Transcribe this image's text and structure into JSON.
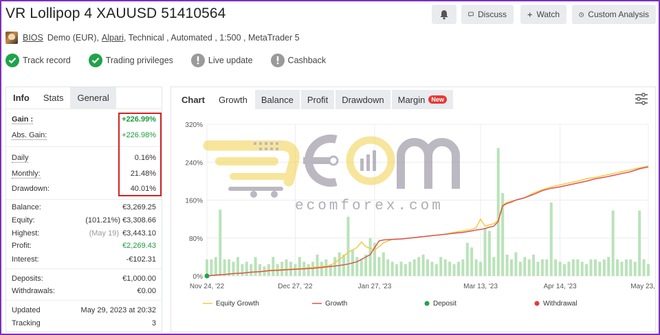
{
  "title": "VR Lollipop 4 XAUUSD 51410564",
  "header_buttons": {
    "discuss": "Discuss",
    "watch": "Watch",
    "custom_analysis": "Custom Analysis"
  },
  "meta": {
    "author": "BIOS",
    "account": "Demo (EUR),",
    "broker": "Alpari",
    "rest": ", Technical , Automated , 1:500 , MetaTrader 5"
  },
  "badges": [
    {
      "label": "Track record",
      "status": "ok"
    },
    {
      "label": "Trading privileges",
      "status": "ok"
    },
    {
      "label": "Live update",
      "status": "off"
    },
    {
      "label": "Cashback",
      "status": "off"
    }
  ],
  "left_tabs": [
    "Info",
    "Stats",
    "General"
  ],
  "stats": {
    "gain": {
      "label": "Gain :",
      "value": "+226.99%"
    },
    "abs_gain": {
      "label": "Abs. Gain:",
      "value": "+226.98%"
    },
    "daily": {
      "label": "Daily",
      "value": "0.16%"
    },
    "monthly": {
      "label": "Monthly:",
      "value": "21.48%"
    },
    "drawdown": {
      "label": "Drawdown:",
      "value": "40.01%"
    },
    "balance": {
      "label": "Balance:",
      "value": "€3,269.25"
    },
    "equity": {
      "label": "Equity:",
      "prefix": "(101.21%)",
      "value": "€3,308.66"
    },
    "highest": {
      "label": "Highest:",
      "prefix": "(May 19)",
      "value": "€3,443.10"
    },
    "profit": {
      "label": "Profit:",
      "value": "€2,269.43"
    },
    "interest": {
      "label": "Interest:",
      "value": "-€102.31"
    },
    "deposits": {
      "label": "Deposits:",
      "value": "€1,000.00"
    },
    "withdrawals": {
      "label": "Withdrawals:",
      "value": "€0.00"
    },
    "updated": {
      "label": "Updated",
      "value": "May 29, 2023 at 20:32"
    },
    "tracking": {
      "label": "Tracking",
      "value": "3"
    }
  },
  "right_tabs": [
    "Chart",
    "Growth",
    "Balance",
    "Profit",
    "Drawdown",
    "Margin"
  ],
  "margin_badge": "New",
  "watermark": {
    "text": "ecomforex.com"
  },
  "colors": {
    "equity": "#f5c842",
    "growth": "#d9534f",
    "deposit": "#1fa34a",
    "withdrawal": "#e53935",
    "bars": "#b9e3b9",
    "positive": "#1a9b3a",
    "highlight": "#d12222"
  },
  "chart_data": {
    "type": "line",
    "ylim": [
      0,
      320
    ],
    "yticks": [
      0,
      80,
      160,
      240,
      320
    ],
    "ytick_labels": [
      "0%",
      "80%",
      "160%",
      "240%",
      "320%"
    ],
    "xtick_labels": [
      "Nov 24, '22",
      "Dec 27, '22",
      "Jan 27, '23",
      "Mar 13, '23",
      "Apr 14, '23",
      "May 23, '23"
    ],
    "xtick_index": [
      0,
      20,
      38,
      62,
      80,
      100
    ],
    "n_points": 101,
    "grid": true,
    "legend": [
      "Equity Growth",
      "Growth",
      "Deposit",
      "Withdrawal"
    ],
    "legend_position": "bottom",
    "equity_growth": [
      [
        0,
        0
      ],
      [
        2,
        2
      ],
      [
        4,
        3
      ],
      [
        6,
        5
      ],
      [
        8,
        6
      ],
      [
        10,
        8
      ],
      [
        12,
        9
      ],
      [
        14,
        12
      ],
      [
        16,
        13
      ],
      [
        18,
        14
      ],
      [
        20,
        15
      ],
      [
        22,
        16
      ],
      [
        24,
        18
      ],
      [
        26,
        20
      ],
      [
        28,
        22
      ],
      [
        29,
        28
      ],
      [
        30,
        35
      ],
      [
        31,
        42
      ],
      [
        32,
        50
      ],
      [
        33,
        55
      ],
      [
        34,
        60
      ],
      [
        35,
        72
      ],
      [
        36,
        62
      ],
      [
        37,
        58
      ],
      [
        38,
        55
      ],
      [
        39,
        62
      ],
      [
        40,
        70
      ],
      [
        42,
        77
      ],
      [
        44,
        78
      ],
      [
        46,
        80
      ],
      [
        48,
        82
      ],
      [
        50,
        84
      ],
      [
        52,
        86
      ],
      [
        54,
        88
      ],
      [
        56,
        92
      ],
      [
        58,
        95
      ],
      [
        60,
        98
      ],
      [
        61,
        102
      ],
      [
        62,
        120
      ],
      [
        63,
        105
      ],
      [
        64,
        108
      ],
      [
        65,
        110
      ],
      [
        66,
        118
      ],
      [
        67,
        150
      ],
      [
        68,
        155
      ],
      [
        69,
        158
      ],
      [
        70,
        160
      ],
      [
        72,
        165
      ],
      [
        74,
        175
      ],
      [
        76,
        182
      ],
      [
        78,
        188
      ],
      [
        80,
        192
      ],
      [
        82,
        196
      ],
      [
        84,
        200
      ],
      [
        86,
        205
      ],
      [
        88,
        208
      ],
      [
        90,
        212
      ],
      [
        92,
        216
      ],
      [
        94,
        220
      ],
      [
        96,
        224
      ],
      [
        98,
        228
      ],
      [
        100,
        232
      ]
    ],
    "growth": [
      [
        0,
        0
      ],
      [
        2,
        2
      ],
      [
        4,
        3
      ],
      [
        6,
        5
      ],
      [
        8,
        6
      ],
      [
        10,
        8
      ],
      [
        12,
        9
      ],
      [
        14,
        11
      ],
      [
        16,
        12
      ],
      [
        18,
        13
      ],
      [
        20,
        14
      ],
      [
        22,
        15
      ],
      [
        24,
        16
      ],
      [
        26,
        18
      ],
      [
        28,
        20
      ],
      [
        30,
        22
      ],
      [
        32,
        25
      ],
      [
        34,
        30
      ],
      [
        36,
        40
      ],
      [
        37,
        45
      ],
      [
        38,
        60
      ],
      [
        39,
        74
      ],
      [
        40,
        76
      ],
      [
        42,
        77
      ],
      [
        44,
        78
      ],
      [
        46,
        80
      ],
      [
        48,
        82
      ],
      [
        50,
        84
      ],
      [
        52,
        86
      ],
      [
        54,
        88
      ],
      [
        56,
        90
      ],
      [
        58,
        92
      ],
      [
        60,
        95
      ],
      [
        61,
        97
      ],
      [
        62,
        98
      ],
      [
        63,
        100
      ],
      [
        64,
        103
      ],
      [
        65,
        105
      ],
      [
        66,
        115
      ],
      [
        67,
        148
      ],
      [
        68,
        153
      ],
      [
        69,
        156
      ],
      [
        70,
        160
      ],
      [
        72,
        165
      ],
      [
        74,
        172
      ],
      [
        76,
        180
      ],
      [
        78,
        185
      ],
      [
        80,
        188
      ],
      [
        82,
        192
      ],
      [
        84,
        196
      ],
      [
        86,
        200
      ],
      [
        88,
        205
      ],
      [
        90,
        208
      ],
      [
        92,
        212
      ],
      [
        94,
        216
      ],
      [
        96,
        220
      ],
      [
        98,
        226
      ],
      [
        100,
        230
      ]
    ],
    "bars": [
      [
        0,
        35
      ],
      [
        1,
        35
      ],
      [
        2,
        40
      ],
      [
        3,
        140
      ],
      [
        4,
        35
      ],
      [
        5,
        35
      ],
      [
        6,
        30
      ],
      [
        7,
        40
      ],
      [
        8,
        25
      ],
      [
        9,
        30
      ],
      [
        10,
        25
      ],
      [
        11,
        40
      ],
      [
        12,
        25
      ],
      [
        13,
        20
      ],
      [
        14,
        25
      ],
      [
        15,
        40
      ],
      [
        16,
        25
      ],
      [
        17,
        30
      ],
      [
        18,
        35
      ],
      [
        19,
        30
      ],
      [
        20,
        25
      ],
      [
        21,
        40
      ],
      [
        22,
        30
      ],
      [
        23,
        25
      ],
      [
        24,
        30
      ],
      [
        25,
        45
      ],
      [
        26,
        30
      ],
      [
        27,
        35
      ],
      [
        28,
        25
      ],
      [
        29,
        40
      ],
      [
        30,
        50
      ],
      [
        31,
        45
      ],
      [
        32,
        125
      ],
      [
        33,
        55
      ],
      [
        34,
        40
      ],
      [
        35,
        35
      ],
      [
        36,
        45
      ],
      [
        37,
        80
      ],
      [
        38,
        70
      ],
      [
        39,
        40
      ],
      [
        40,
        50
      ],
      [
        41,
        35
      ],
      [
        42,
        30
      ],
      [
        43,
        25
      ],
      [
        44,
        30
      ],
      [
        45,
        25
      ],
      [
        46,
        30
      ],
      [
        47,
        35
      ],
      [
        48,
        40
      ],
      [
        49,
        45
      ],
      [
        50,
        35
      ],
      [
        51,
        30
      ],
      [
        52,
        25
      ],
      [
        53,
        40
      ],
      [
        54,
        35
      ],
      [
        55,
        30
      ],
      [
        56,
        25
      ],
      [
        57,
        30
      ],
      [
        58,
        35
      ],
      [
        59,
        70
      ],
      [
        60,
        60
      ],
      [
        61,
        35
      ],
      [
        62,
        30
      ],
      [
        63,
        100
      ],
      [
        64,
        95
      ],
      [
        65,
        40
      ],
      [
        66,
        270
      ],
      [
        67,
        175
      ],
      [
        68,
        45
      ],
      [
        69,
        35
      ],
      [
        70,
        50
      ],
      [
        71,
        30
      ],
      [
        72,
        40
      ],
      [
        73,
        35
      ],
      [
        74,
        45
      ],
      [
        75,
        30
      ],
      [
        76,
        35
      ],
      [
        77,
        35
      ],
      [
        78,
        155
      ],
      [
        79,
        35
      ],
      [
        80,
        30
      ],
      [
        81,
        25
      ],
      [
        82,
        30
      ],
      [
        83,
        35
      ],
      [
        84,
        35
      ],
      [
        85,
        30
      ],
      [
        86,
        25
      ],
      [
        87,
        35
      ],
      [
        88,
        35
      ],
      [
        89,
        30
      ],
      [
        90,
        35
      ],
      [
        91,
        40
      ],
      [
        92,
        138
      ],
      [
        93,
        35
      ],
      [
        94,
        30
      ],
      [
        95,
        35
      ],
      [
        96,
        35
      ],
      [
        97,
        30
      ],
      [
        98,
        138
      ],
      [
        99,
        35
      ],
      [
        100,
        25
      ]
    ],
    "deposits": [
      [
        0,
        0
      ]
    ]
  }
}
